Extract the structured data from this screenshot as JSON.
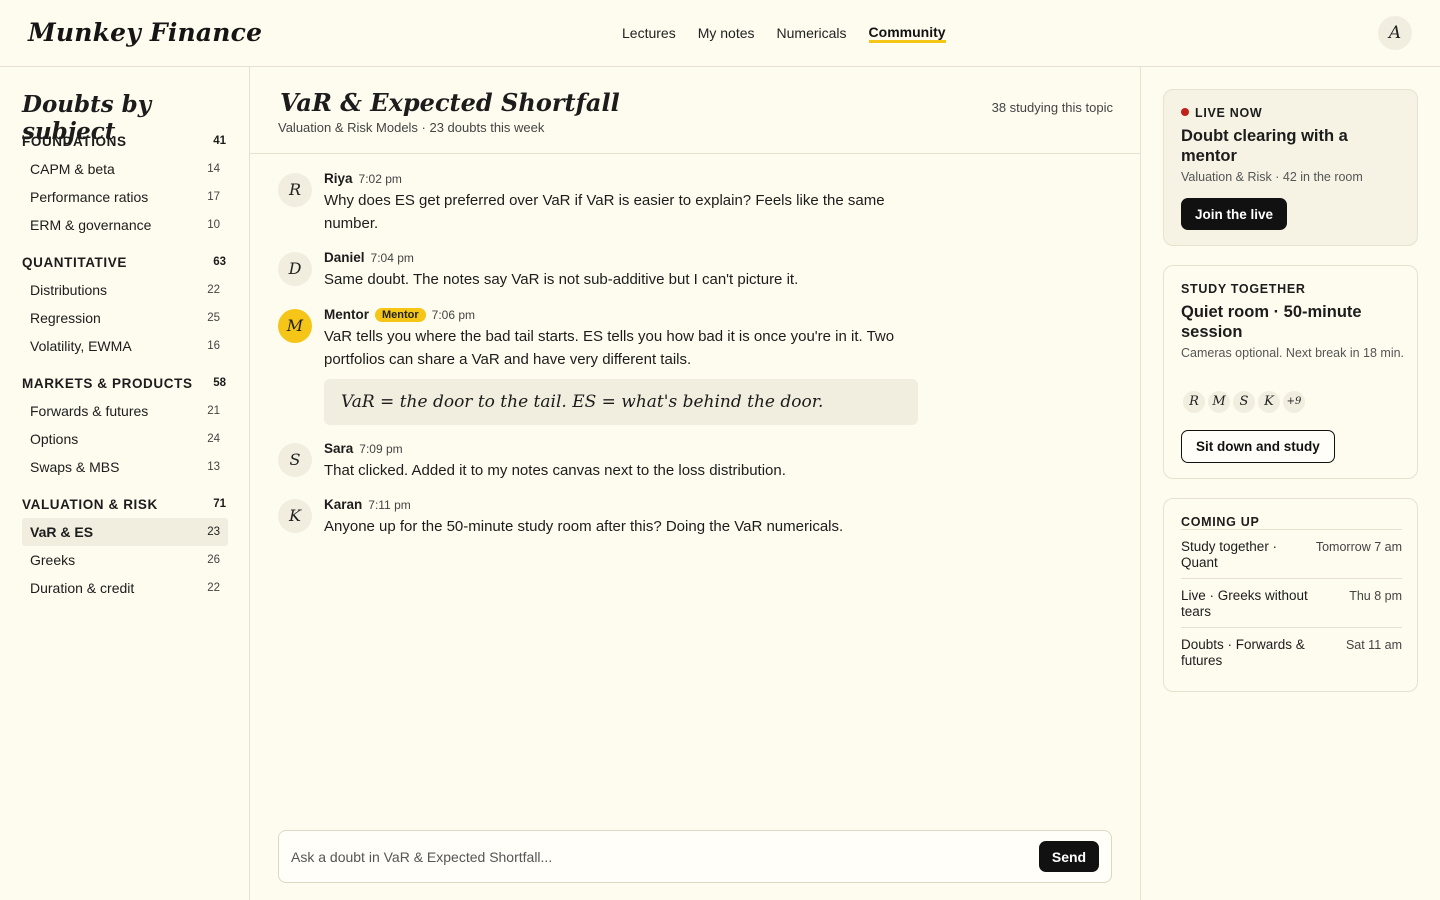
{
  "app": {
    "logo": "Munkey Finance",
    "user_initial": "A"
  },
  "nav": [
    {
      "label": "Lectures",
      "active": false
    },
    {
      "label": "My notes",
      "active": false
    },
    {
      "label": "Numericals",
      "active": false
    },
    {
      "label": "Community",
      "active": true
    }
  ],
  "sidebar": {
    "title": "Doubts by subject",
    "groups": [
      {
        "name": "FOUNDATIONS",
        "count": "41",
        "items": [
          {
            "name": "CAPM & beta",
            "count": "14"
          },
          {
            "name": "Performance ratios",
            "count": "17"
          },
          {
            "name": "ERM & governance",
            "count": "10"
          }
        ]
      },
      {
        "name": "QUANTITATIVE",
        "count": "63",
        "items": [
          {
            "name": "Distributions",
            "count": "22"
          },
          {
            "name": "Regression",
            "count": "25"
          },
          {
            "name": "Volatility, EWMA",
            "count": "16"
          }
        ]
      },
      {
        "name": "MARKETS & PRODUCTS",
        "count": "58",
        "items": [
          {
            "name": "Forwards & futures",
            "count": "21"
          },
          {
            "name": "Options",
            "count": "24"
          },
          {
            "name": "Swaps & MBS",
            "count": "13"
          }
        ]
      },
      {
        "name": "VALUATION & RISK",
        "count": "71",
        "items": [
          {
            "name": "VaR & ES",
            "count": "23",
            "active": true
          },
          {
            "name": "Greeks",
            "count": "26"
          },
          {
            "name": "Duration & credit",
            "count": "22"
          }
        ]
      }
    ]
  },
  "topic": {
    "title": "VaR & Expected Shortfall",
    "subtitle": "Valuation & Risk Models · 23 doubts this week",
    "studying": "38 studying this topic"
  },
  "messages": [
    {
      "initial": "R",
      "author": "Riya",
      "time": "7:02 pm",
      "text": "Why does ES get preferred over VaR if VaR is easier to explain? Feels like the same number."
    },
    {
      "initial": "D",
      "author": "Daniel",
      "time": "7:04 pm",
      "text": "Same doubt. The notes say VaR is not sub-additive but I can't picture it."
    },
    {
      "initial": "M",
      "author": "Mentor",
      "badge": "Mentor",
      "time": "7:06 pm",
      "text": "VaR tells you where the bad tail starts. ES tells you how bad it is once you're in it. Two portfolios can share a VaR and have very different tails.",
      "quote": "VaR = the door to the tail. ES = what's behind the door."
    },
    {
      "initial": "S",
      "author": "Sara",
      "time": "7:09 pm",
      "text": "That clicked. Added it to my notes canvas next to the loss distribution."
    },
    {
      "initial": "K",
      "author": "Karan",
      "time": "7:11 pm",
      "text": "Anyone up for the 50-minute study room after this? Doing the VaR numericals."
    }
  ],
  "composer": {
    "placeholder": "Ask a doubt in VaR & Expected Shortfall...",
    "send_label": "Send"
  },
  "live": {
    "eyebrow": "LIVE NOW",
    "title": "Doubt clearing with a mentor",
    "subtitle": "Valuation & Risk · 42 in the room",
    "button": "Join the live"
  },
  "study": {
    "eyebrow": "STUDY TOGETHER",
    "title": "Quiet room · 50-minute session",
    "subtitle": "Cameras optional. Next break in 18 min.",
    "avatars": [
      "R",
      "M",
      "S",
      "K"
    ],
    "more": "+9",
    "button": "Sit down and study"
  },
  "coming": {
    "eyebrow": "COMING UP",
    "items": [
      {
        "what": "Study together · Quant",
        "when": "Tomorrow 7 am"
      },
      {
        "what": "Live · Greeks without tears",
        "when": "Thu 8 pm"
      },
      {
        "what": "Doubts · Forwards & futures",
        "when": "Sat 11 am"
      }
    ]
  }
}
